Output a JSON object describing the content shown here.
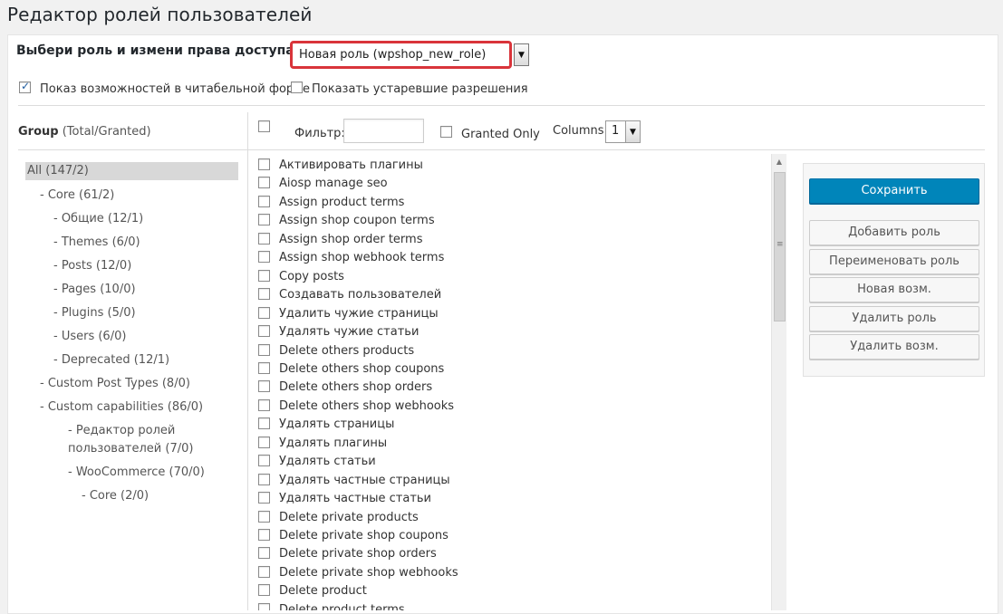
{
  "page": {
    "title": "Редактор ролей пользователей"
  },
  "role_selector": {
    "label": "Выбери роль и измени права доступа",
    "selected": "Новая роль (wpshop_new_role)"
  },
  "options": {
    "human_readable": {
      "label": "Показ возможностей в читабельной форме",
      "checked": true
    },
    "deprecated": {
      "label": "Показать устаревшие разрешения",
      "checked": false
    }
  },
  "group_header": {
    "title": "Group",
    "subtitle": "(Total/Granted)"
  },
  "toolbar": {
    "filter_label": "Фильтр:",
    "filter_value": "",
    "granted_only_label": "Granted Only",
    "columns_label": "Columns:",
    "columns_value": "1"
  },
  "groups": [
    {
      "label": "All (147/2)",
      "selected": true
    },
    {
      "label": "- Core (61/2)"
    },
    {
      "label": "- Общие (12/1)"
    },
    {
      "label": "- Themes (6/0)"
    },
    {
      "label": "- Posts (12/0)"
    },
    {
      "label": "- Pages (10/0)"
    },
    {
      "label": "- Plugins (5/0)"
    },
    {
      "label": "- Users (6/0)"
    },
    {
      "label": "- Deprecated (12/1)"
    },
    {
      "label": "- Custom Post Types (8/0)"
    },
    {
      "label": "- Custom capabilities (86/0)"
    },
    {
      "label": "- Редактор ролей"
    },
    {
      "label": "пользователей (7/0)"
    },
    {
      "label": "- WooCommerce (70/0)"
    },
    {
      "label": "- Core (2/0)"
    }
  ],
  "capabilities": [
    "Активировать плагины",
    "Aiosp manage seo",
    "Assign product terms",
    "Assign shop coupon terms",
    "Assign shop order terms",
    "Assign shop webhook terms",
    "Copy posts",
    "Создавать пользователей",
    "Удалить чужие страницы",
    "Удалять чужие статьи",
    "Delete others products",
    "Delete others shop coupons",
    "Delete others shop orders",
    "Delete others shop webhooks",
    "Удалять страницы",
    "Удалять плагины",
    "Удалять статьи",
    "Удалять частные страницы",
    "Удалять частные статьи",
    "Delete private products",
    "Delete private shop coupons",
    "Delete private shop orders",
    "Delete private shop webhooks",
    "Delete product",
    "Delete product terms"
  ],
  "actions": {
    "save": "Сохранить",
    "add_role": "Добавить роль",
    "rename_role": "Переименовать роль",
    "new_cap": "Новая возм.",
    "delete_role": "Удалить роль",
    "delete_cap": "Удалить возм."
  },
  "colors": {
    "primary": "#0085ba",
    "highlight_border": "#d9343a"
  }
}
